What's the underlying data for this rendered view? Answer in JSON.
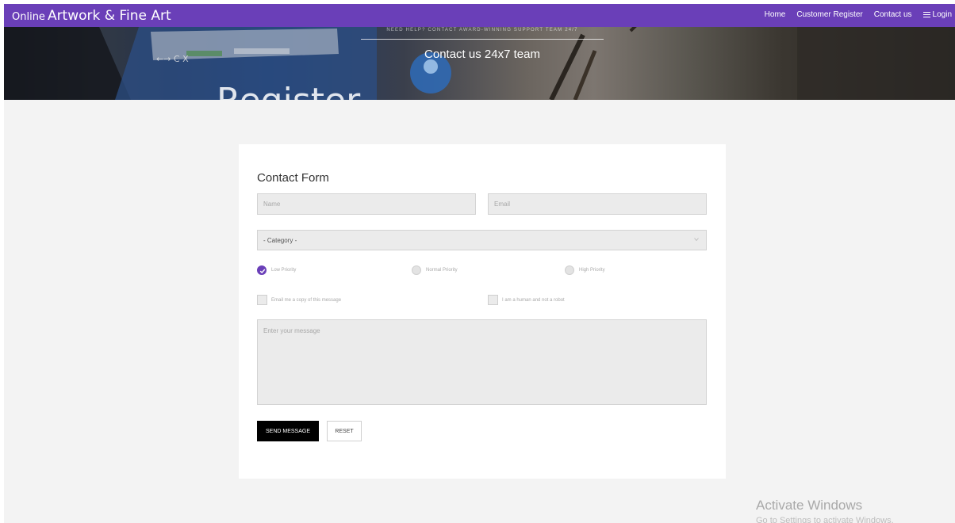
{
  "nav": {
    "brand_small": "Online",
    "brand_large": "Artwork & Fine Art",
    "links": [
      "Home",
      "Customer Register",
      "Contact us"
    ],
    "login_label": "Login",
    "bar_color": "#6a3fb8"
  },
  "hero": {
    "tagline": "NEED HELP? CONTACT AWARD-WINNING SUPPORT TEAM 24/7",
    "title": "Contact us 24x7 team",
    "background_word": "Register"
  },
  "form": {
    "title": "Contact Form",
    "name_placeholder": "Name",
    "email_placeholder": "Email",
    "category_selected": "- Category -",
    "priority_options": [
      {
        "label": "Low Priority",
        "checked": true
      },
      {
        "label": "Normal Priority",
        "checked": false
      },
      {
        "label": "High Priority",
        "checked": false
      }
    ],
    "checkboxes": [
      {
        "label": "Email me a copy of this message",
        "checked": false
      },
      {
        "label": "I am a human and not a robot",
        "checked": false
      }
    ],
    "message_placeholder": "Enter your message",
    "send_label": "SEND MESSAGE",
    "reset_label": "RESET"
  },
  "watermark": {
    "title": "Activate Windows",
    "subtitle": "Go to Settings to activate Windows."
  },
  "icons": {
    "menu": "menu-icon",
    "radio_check": "check-icon",
    "select_arrow": "chevron-down-icon"
  },
  "colors": {
    "accent": "#6a3fb8",
    "page_bg": "#f3f3f3",
    "field_bg": "#ebebeb",
    "send_bg": "#000000"
  }
}
